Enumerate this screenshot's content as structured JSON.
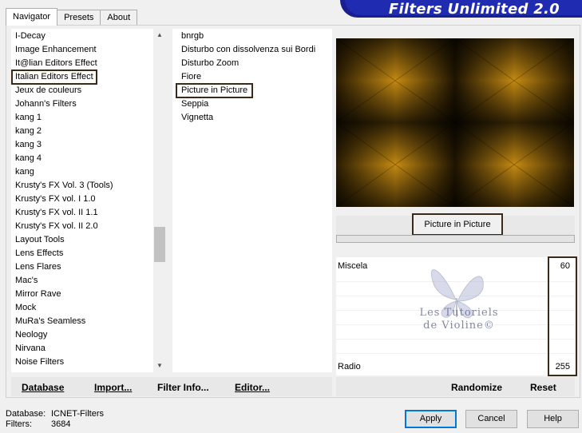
{
  "tabs": [
    {
      "label": "Navigator",
      "active": true
    },
    {
      "label": "Presets",
      "active": false
    },
    {
      "label": "About",
      "active": false
    }
  ],
  "banner": {
    "title": "Filters Unlimited 2.0"
  },
  "categories": [
    "I-Decay",
    "Image Enhancement",
    "It@lian Editors Effect",
    "Italian Editors Effect",
    "Jeux de couleurs",
    "Johann's Filters",
    "kang 1",
    "kang 2",
    "kang 3",
    "kang 4",
    "kang",
    "Krusty's FX Vol. 3 (Tools)",
    "Krusty's FX vol. I 1.0",
    "Krusty's FX vol. II 1.1",
    "Krusty's FX vol. II 2.0",
    "Layout Tools",
    "Lens Effects",
    "Lens Flares",
    "Mac's",
    "Mirror Rave",
    "Mock",
    "MuRa's Seamless",
    "Neology",
    "Nirvana",
    "Noise Filters"
  ],
  "selected_category": "Italian Editors Effect",
  "filters": [
    "bnrgb",
    "Disturbo con dissolvenza sui Bordi",
    "Disturbo Zoom",
    "Fiore",
    "Picture in Picture",
    "Seppia",
    "Vignetta"
  ],
  "selected_filter": "Picture in Picture",
  "filter_title": "Picture in Picture",
  "params": [
    {
      "label": "Miscela",
      "value": "60"
    },
    {
      "label": "Radio",
      "value": "255"
    }
  ],
  "watermark": {
    "line1": "Les Tutoriels",
    "line2": "de Violine©"
  },
  "toolbar": {
    "database": "Database",
    "import": "Import...",
    "filter_info": "Filter Info...",
    "editor": "Editor...",
    "randomize": "Randomize",
    "reset": "Reset"
  },
  "status": {
    "database_key": "Database:",
    "database_value": "ICNET-Filters",
    "filters_key": "Filters:",
    "filters_value": "3684"
  },
  "buttons": {
    "apply": "Apply",
    "cancel": "Cancel",
    "help": "Help"
  },
  "colors": {
    "banner": "#1f2bb0",
    "preview_gold": "#c88a10",
    "highlight_border": "#3b2a1a"
  },
  "icons": {
    "scroll_up": "chevron-up-icon",
    "scroll_down": "chevron-down-icon"
  }
}
